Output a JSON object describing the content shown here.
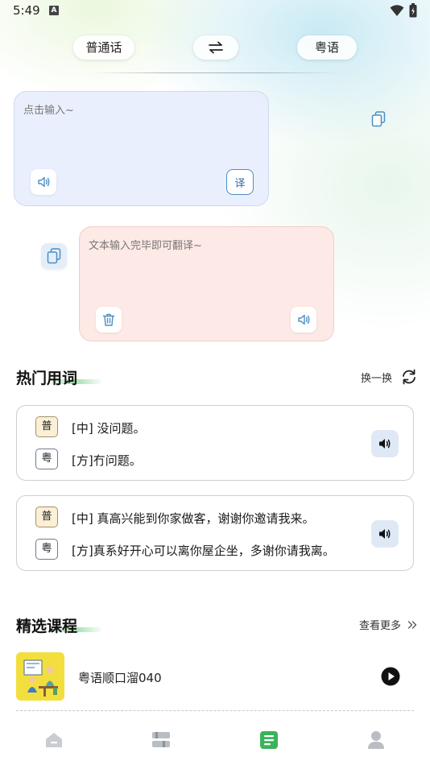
{
  "status_bar": {
    "time": "5:49",
    "notification_letter": "A"
  },
  "language_bar": {
    "source_lang": "普通话",
    "target_lang": "粤语",
    "swap_icon": "swap-arrows-icon"
  },
  "translator": {
    "input_placeholder": "点击输入~",
    "translate_label": "译",
    "output_placeholder": "文本输入完毕即可翻译~"
  },
  "hot_words": {
    "title": "热门用词",
    "refresh_label": "换一换",
    "items": [
      {
        "pu_tag": "普",
        "pu_text": "[中] 没问题。",
        "yue_tag": "粤",
        "yue_text": "[方]冇问题。"
      },
      {
        "pu_tag": "普",
        "pu_text": "[中] 真高兴能到你家做客，谢谢你邀请我来。",
        "yue_tag": "粤",
        "yue_text": "[方]真系好开心可以离你屋企坐，多谢你请我离。"
      }
    ]
  },
  "courses": {
    "title": "精选课程",
    "more_label": "查看更多",
    "items": [
      {
        "title": "粤语顺口溜040"
      }
    ]
  },
  "colors": {
    "accent_blue": "#4a8fc4",
    "input_bg": "#e8eefc",
    "output_bg": "#fde8e4",
    "nav_active": "#3bb35a"
  },
  "bottom_nav": {
    "items": [
      "home-icon",
      "library-icon",
      "notes-icon",
      "profile-icon"
    ],
    "active_index": 2
  }
}
